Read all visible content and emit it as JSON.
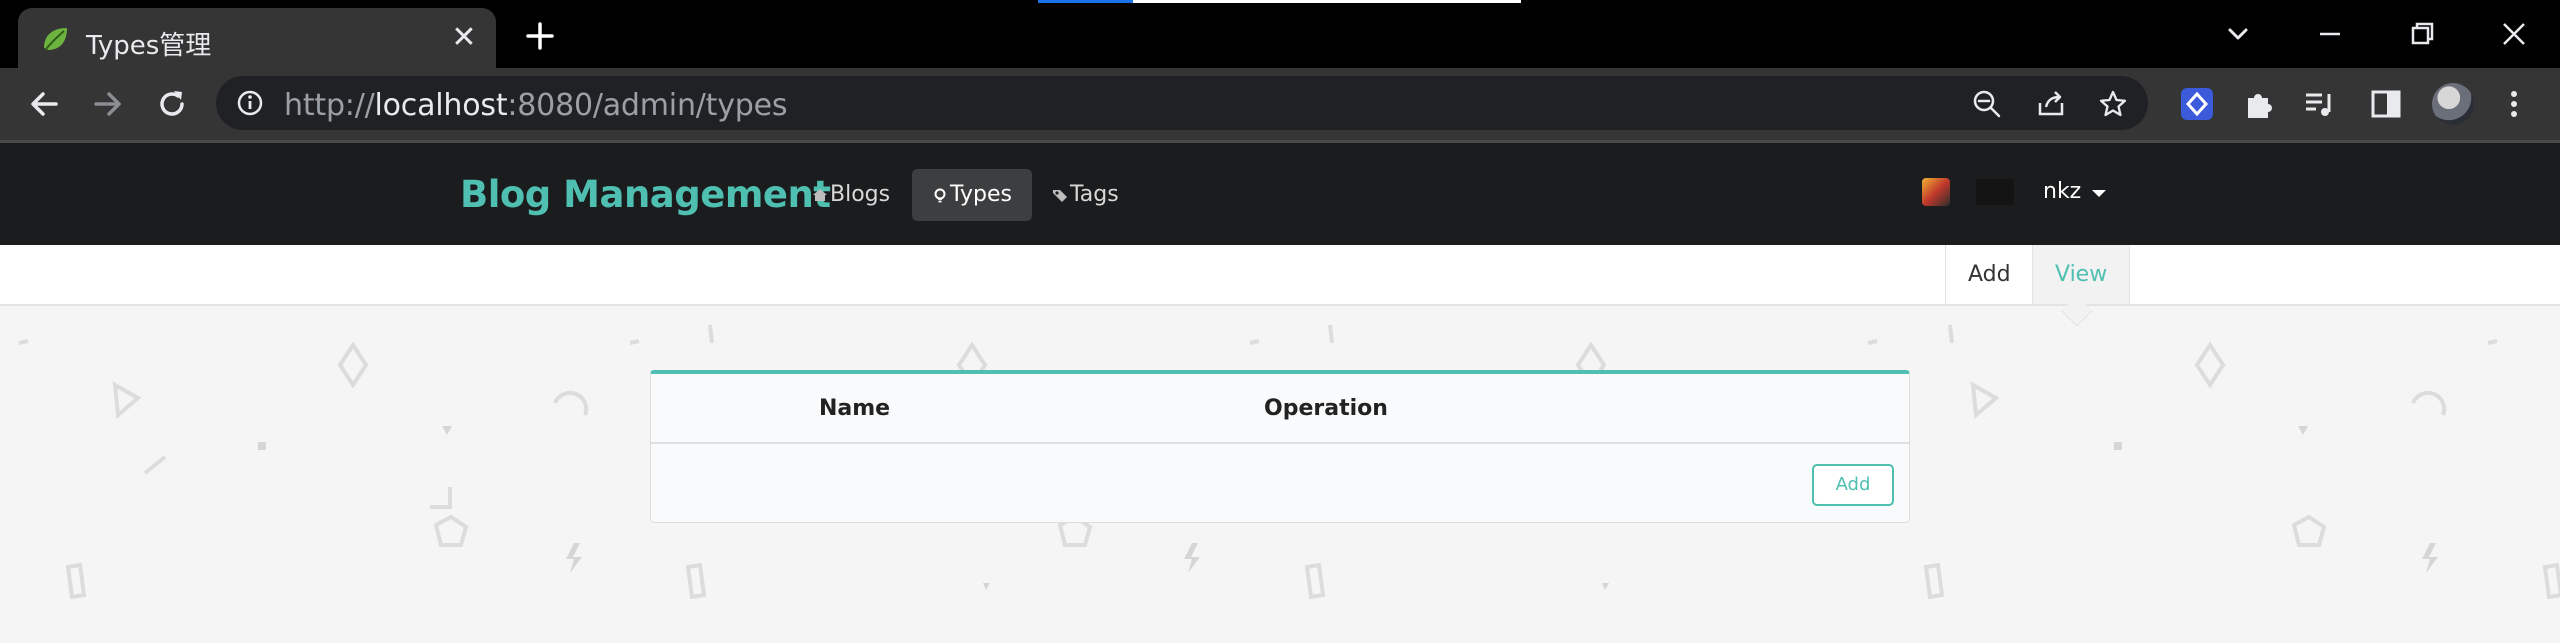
{
  "browser": {
    "tab": {
      "title": "Types管理",
      "favicon": "spring-leaf-icon",
      "close_glyph": "✕"
    },
    "url": {
      "prefix": "http://",
      "host": "localhost",
      "rest": ":8080/admin/types"
    },
    "accent_color": "#1a73e8"
  },
  "app": {
    "brand": "Blog Management",
    "brand_color": "#4ebfb0",
    "menu": [
      {
        "label": "Blogs",
        "icon": "home-icon"
      },
      {
        "label": "Types",
        "icon": "bulb-icon",
        "active": true
      },
      {
        "label": "Tags",
        "icon": "tags-icon"
      }
    ],
    "user": {
      "name": "nkz"
    }
  },
  "subnav": {
    "items": [
      {
        "label": "Add"
      },
      {
        "label": "View",
        "active": true
      }
    ]
  },
  "types_table": {
    "columns": [
      "Name",
      "Operation"
    ],
    "rows": [],
    "add_button": "Add"
  }
}
